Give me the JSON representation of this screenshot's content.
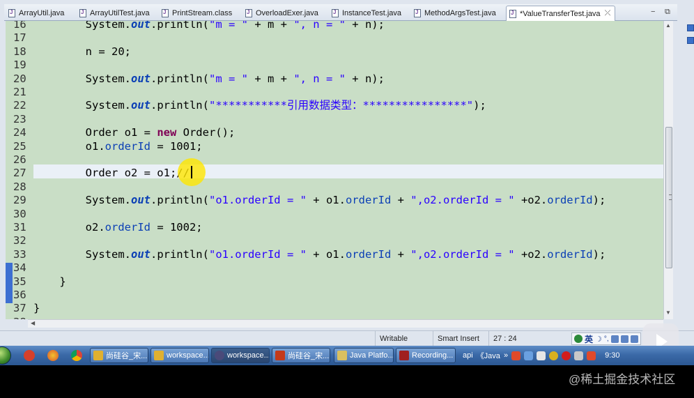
{
  "tabs": [
    {
      "label": "ArrayUtil.java",
      "active": false
    },
    {
      "label": "ArrayUtilTest.java",
      "active": false
    },
    {
      "label": "PrintStream.class",
      "active": false
    },
    {
      "label": "OverloadExer.java",
      "active": false
    },
    {
      "label": "InstanceTest.java",
      "active": false
    },
    {
      "label": "MethodArgsTest.java",
      "active": false
    },
    {
      "label": "*ValueTransferTest.java",
      "active": true
    }
  ],
  "tab_close_symbol": "⤫",
  "tab_controls": {
    "minimize": "−",
    "maximize": "⧉"
  },
  "editor": {
    "current_line": 27,
    "lines": [
      {
        "n": "16",
        "parts": [
          {
            "t": "        System."
          },
          {
            "t": "out",
            "c": "fld"
          },
          {
            "t": ".println("
          },
          {
            "t": "\"m = \"",
            "c": "str"
          },
          {
            "t": " + m + "
          },
          {
            "t": "\", n = \"",
            "c": "str"
          },
          {
            "t": " + n);"
          }
        ]
      },
      {
        "n": "17",
        "parts": []
      },
      {
        "n": "18",
        "parts": [
          {
            "t": "        n = 20;"
          }
        ]
      },
      {
        "n": "19",
        "parts": []
      },
      {
        "n": "20",
        "parts": [
          {
            "t": "        System."
          },
          {
            "t": "out",
            "c": "fld"
          },
          {
            "t": ".println("
          },
          {
            "t": "\"m = \"",
            "c": "str"
          },
          {
            "t": " + m + "
          },
          {
            "t": "\", n = \"",
            "c": "str"
          },
          {
            "t": " + n);"
          }
        ]
      },
      {
        "n": "21",
        "parts": []
      },
      {
        "n": "22",
        "parts": [
          {
            "t": "        System."
          },
          {
            "t": "out",
            "c": "fld"
          },
          {
            "t": ".println("
          },
          {
            "t": "\"***********引用数据类型：****************\"",
            "c": "str"
          },
          {
            "t": ");"
          }
        ]
      },
      {
        "n": "23",
        "parts": []
      },
      {
        "n": "24",
        "parts": [
          {
            "t": "        Order o1 = "
          },
          {
            "t": "new",
            "c": "kw"
          },
          {
            "t": " Order();"
          }
        ]
      },
      {
        "n": "25",
        "parts": [
          {
            "t": "        o1."
          },
          {
            "t": "orderId",
            "c": "var"
          },
          {
            "t": " = 1001;"
          }
        ]
      },
      {
        "n": "26",
        "parts": []
      },
      {
        "n": "27",
        "parts": [
          {
            "t": "        Order o2 = o1;//"
          }
        ]
      },
      {
        "n": "28",
        "parts": []
      },
      {
        "n": "29",
        "parts": [
          {
            "t": "        System."
          },
          {
            "t": "out",
            "c": "fld"
          },
          {
            "t": ".println("
          },
          {
            "t": "\"o1.orderId = \"",
            "c": "str"
          },
          {
            "t": " + o1."
          },
          {
            "t": "orderId",
            "c": "var"
          },
          {
            "t": " + "
          },
          {
            "t": "\",o2.orderId = \"",
            "c": "str"
          },
          {
            "t": " +o2."
          },
          {
            "t": "orderId",
            "c": "var"
          },
          {
            "t": ");"
          }
        ]
      },
      {
        "n": "30",
        "parts": []
      },
      {
        "n": "31",
        "parts": [
          {
            "t": "        o2."
          },
          {
            "t": "orderId",
            "c": "var"
          },
          {
            "t": " = 1002;"
          }
        ]
      },
      {
        "n": "32",
        "parts": []
      },
      {
        "n": "33",
        "parts": [
          {
            "t": "        System."
          },
          {
            "t": "out",
            "c": "fld"
          },
          {
            "t": ".println("
          },
          {
            "t": "\"o1.orderId = \"",
            "c": "str"
          },
          {
            "t": " + o1."
          },
          {
            "t": "orderId",
            "c": "var"
          },
          {
            "t": " + "
          },
          {
            "t": "\",o2.orderId = \"",
            "c": "str"
          },
          {
            "t": " +o2."
          },
          {
            "t": "orderId",
            "c": "var"
          },
          {
            "t": ");"
          }
        ]
      },
      {
        "n": "34",
        "parts": []
      },
      {
        "n": "35",
        "parts": [
          {
            "t": "    }"
          }
        ]
      },
      {
        "n": "36",
        "parts": []
      },
      {
        "n": "37",
        "parts": [
          {
            "t": "}"
          }
        ]
      },
      {
        "n": "38",
        "parts": []
      }
    ]
  },
  "status": {
    "writable": "Writable",
    "insert_mode": "Smart Insert",
    "position": "27 : 24"
  },
  "ime": {
    "lang": "英",
    "moon": "☽",
    "punct": "°,"
  },
  "taskbar": {
    "buttons": [
      {
        "label": "尚硅谷_宋...",
        "icon_color": "#e0b030",
        "active": false
      },
      {
        "label": "workspace...",
        "icon_color": "#e0b030",
        "active": false
      },
      {
        "label": "workspace...",
        "icon_color": "#4a4a7a",
        "active": true
      },
      {
        "label": "尚硅谷_宋...",
        "icon_color": "#c43a1a",
        "active": false
      },
      {
        "label": "Java Platfo...",
        "icon_color": "#d9c060",
        "active": false
      },
      {
        "label": "Recording...",
        "icon_color": "#a02020",
        "active": false
      }
    ],
    "tray_text": [
      "api",
      "《Java",
      "»"
    ],
    "clock": "9:30"
  },
  "watermark": "@稀土掘金技术社区",
  "colors": {
    "editor_bg": "#c9dec6",
    "current_line": "#eaf0f7",
    "keyword": "#7f0055",
    "string": "#2a00ff",
    "field": "#0b3fb5"
  }
}
